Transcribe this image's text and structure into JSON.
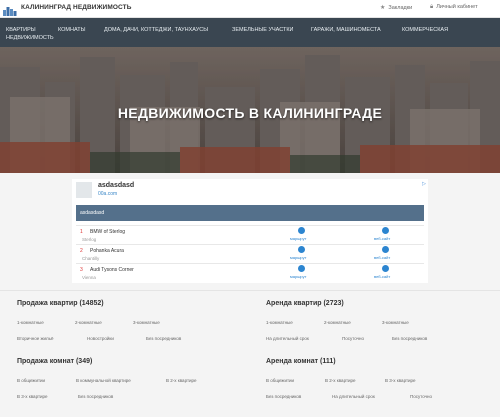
{
  "header": {
    "logo_text": "КАЛИНИНГРАД НЕДВИЖИМОСТЬ",
    "favorites": "Закладки",
    "cabinet": "Личный кабинет"
  },
  "nav": {
    "items": [
      "КВАРТИРЫ НЕДВИЖИМОСТЬ",
      "КОМНАТЫ",
      "ДОМА, ДАЧИ, КОТТЕДЖИ, ТАУНХАУСЫ",
      "ЗЕМЕЛЬНЫЕ УЧАСТКИ",
      "ГАРАЖИ, МАШИНОМЕСТА",
      "КОММЕРЧЕСКАЯ"
    ]
  },
  "hero": {
    "title": "НЕДВИЖИМОСТЬ В КАЛИНИНГРАДЕ"
  },
  "ad": {
    "title": "asdasdasd",
    "url": "00a.com",
    "bar_text": "asdasdasd",
    "rows": [
      {
        "num": "1",
        "name": "BMW of Sterlog",
        "sub": "Sterlog",
        "link1": "маршрут",
        "link2": "веб-сайт"
      },
      {
        "num": "2",
        "name": "Pohanka Acura",
        "sub": "Chantilly",
        "link1": "маршрут",
        "link2": "веб-сайт"
      },
      {
        "num": "3",
        "name": "Audi Tysons Corner",
        "sub": "Vienna",
        "link1": "маршрут",
        "link2": "веб-сайт"
      }
    ]
  },
  "sections": {
    "sale_flats": {
      "title": "Продажа квартир (14852)",
      "links": [
        "1-комнатные",
        "2-комнатные",
        "3-комнатные",
        "Вторичное жильё",
        "Новостройки",
        "Без посредников"
      ]
    },
    "rent_flats": {
      "title": "Аренда квартир (2723)",
      "links": [
        "1-комнатные",
        "2-комнатные",
        "3-комнатные",
        "На длительный срок",
        "Посуточно",
        "Без посредников"
      ]
    },
    "sale_rooms": {
      "title": "Продажа комнат (349)",
      "links": [
        "В общежитии",
        "В коммунальной квартире",
        "В 2-х квартире",
        "В 3-х квартире",
        "Без посредников"
      ]
    },
    "rent_rooms": {
      "title": "Аренда комнат (111)",
      "links": [
        "В общежитии",
        "В 2-х квартире",
        "В 3-х квартире",
        "Без посредников",
        "На длительный срок",
        "Посуточно"
      ]
    }
  }
}
